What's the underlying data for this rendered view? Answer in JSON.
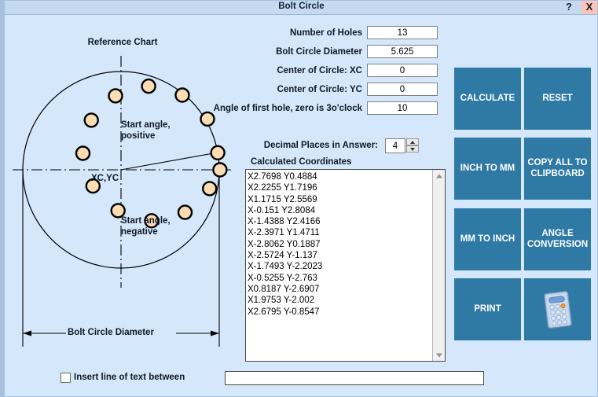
{
  "window": {
    "title": "Bolt Circle",
    "help_label": "?",
    "close_label": "X",
    "accent_color": "#2f79a5",
    "background_color": "#d4e7fb",
    "titlebar_color": "#c5d9f1",
    "close_button_color": "#ffc3bd"
  },
  "diagram": {
    "caption": "Reference Chart",
    "label_start_positive": "Start angle,\npositive",
    "label_start_negative": "Start angle,\nnegative",
    "label_center": "XC,YC",
    "label_diameter": "Bolt Circle Diameter",
    "hole_fill_color": "#fddcb4",
    "hole_stroke_color": "#000000",
    "number_of_holes_drawn": 13,
    "start_angle_drawn_deg": 10
  },
  "form": {
    "fields": [
      {
        "label": "Number of Holes",
        "value": "13",
        "name": "number-of-holes"
      },
      {
        "label": "Bolt Circle Diameter",
        "value": "5.625",
        "name": "bolt-circle-diameter"
      },
      {
        "label": "Center of Circle: XC",
        "value": "0",
        "name": "center-xc"
      },
      {
        "label": "Center of Circle: YC",
        "value": "0",
        "name": "center-yc"
      },
      {
        "label": "Angle of first hole, zero is 3o'clock",
        "value": "10",
        "name": "first-hole-angle"
      }
    ],
    "decimal_places_label": "Decimal Places in Answer:",
    "decimal_places_value": "4"
  },
  "coordinates": {
    "caption": "Calculated Coordinates",
    "lines": [
      "X2.7698 Y0.4884",
      "X2.2255 Y1.7196",
      "X1.1715 Y2.5569",
      "X-0.151 Y2.8084",
      "X-1.4388 Y2.4166",
      "X-2.3971 Y1.4711",
      "X-2.8062 Y0.1887",
      "X-2.5724 Y-1.137",
      "X-1.7493 Y-2.2023",
      "X-0.5255 Y-2.763",
      "X0.8187 Y-2.6907",
      "X1.9753 Y-2.002",
      "X2.6795 Y-0.8547"
    ]
  },
  "buttons": [
    {
      "label": "CALCULATE",
      "name": "calculate-button"
    },
    {
      "label": "RESET",
      "name": "reset-button"
    },
    {
      "label": "INCH TO MM",
      "name": "inch-to-mm-button"
    },
    {
      "label": "COPY ALL TO CLIPBOARD",
      "name": "copy-all-to-clipboard-button"
    },
    {
      "label": "MM TO INCH",
      "name": "mm-to-inch-button"
    },
    {
      "label": "ANGLE CONVERSION",
      "name": "angle-conversion-button"
    },
    {
      "label": "PRINT",
      "name": "print-button"
    },
    {
      "label": "",
      "name": "calculator-button"
    }
  ],
  "bottom": {
    "insert_checkbox_label": "Insert line of text between",
    "insert_checkbox_checked": false,
    "insert_text_value": "",
    "insert_text_placeholder": ""
  }
}
